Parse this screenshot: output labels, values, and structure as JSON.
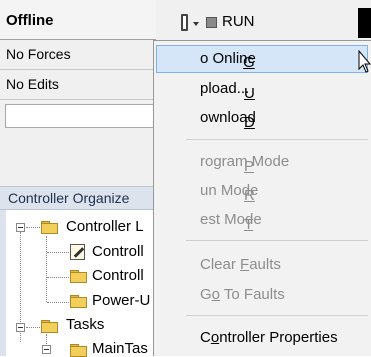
{
  "status": {
    "mode": "Offline",
    "forces": "No Forces",
    "edits": "No Edits"
  },
  "toolbar": {
    "run_label": "RUN"
  },
  "organizer": {
    "title": "Controller Organize",
    "tree": {
      "controller_folder": "Controller L",
      "item1": "Controll",
      "item2": "Controll",
      "item3": "Power-U",
      "tasks": "Tasks",
      "main_task": "MainTas"
    }
  },
  "menu": {
    "items": [
      {
        "pre": "",
        "key": "G",
        "post": "o Online",
        "disabled": false
      },
      {
        "pre": "",
        "key": "U",
        "post": "pload...",
        "disabled": false
      },
      {
        "pre": "",
        "key": "D",
        "post": "ownload",
        "disabled": false
      },
      {
        "pre": "",
        "key": "P",
        "post": "rogram Mode",
        "disabled": true
      },
      {
        "pre": "",
        "key": "R",
        "post": "un Mode",
        "disabled": true
      },
      {
        "pre": "",
        "key": "T",
        "post": "est Mode",
        "disabled": true
      },
      {
        "pre": "Clear ",
        "key": "F",
        "post": "aults",
        "disabled": true
      },
      {
        "pre": "G",
        "key": "o",
        "post": " To Faults",
        "disabled": true
      },
      {
        "pre": "C",
        "key": "o",
        "post": "ntroller Properties",
        "disabled": false
      }
    ]
  }
}
